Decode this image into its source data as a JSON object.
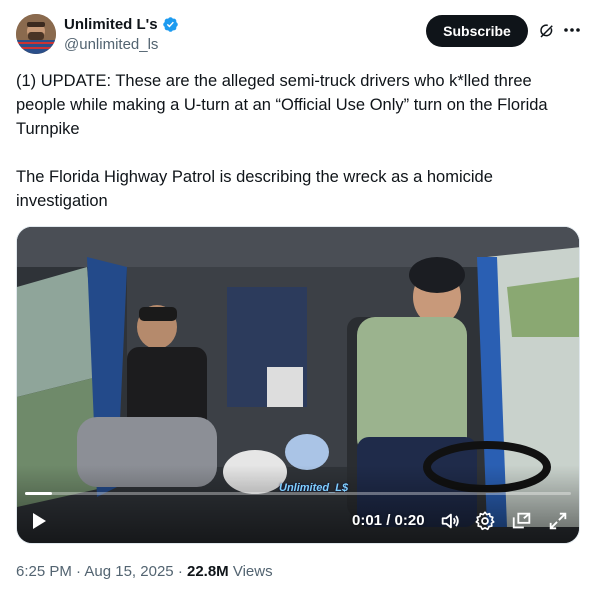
{
  "author": {
    "display_name": "Unlimited L's",
    "handle": "@unlimited_ls",
    "verified": true,
    "verified_color": "#1d9bf0"
  },
  "header": {
    "subscribe_label": "Subscribe",
    "grok_icon": "grok-icon",
    "more_icon": "more-icon"
  },
  "tweet": {
    "text": "(1) UPDATE: These are the alleged semi-truck drivers who k*lled three people while making a U-turn at an “Official Use Only” turn on the Florida Turnpike\n\nThe Florida Highway Patrol is describing the wreck as a homicide investigation"
  },
  "video": {
    "watermark": "Unlimited_L$",
    "current_time": "0:01",
    "duration": "0:20",
    "time_display": "0:01 / 0:20",
    "progress_fraction": 0.05,
    "icons": [
      "play-icon",
      "volume-icon",
      "settings-gear-icon",
      "picture-in-picture-icon",
      "fullscreen-icon"
    ]
  },
  "meta": {
    "time": "6:25 PM",
    "date": "Aug 15, 2025",
    "views_count": "22.8M",
    "views_label": "Views"
  }
}
